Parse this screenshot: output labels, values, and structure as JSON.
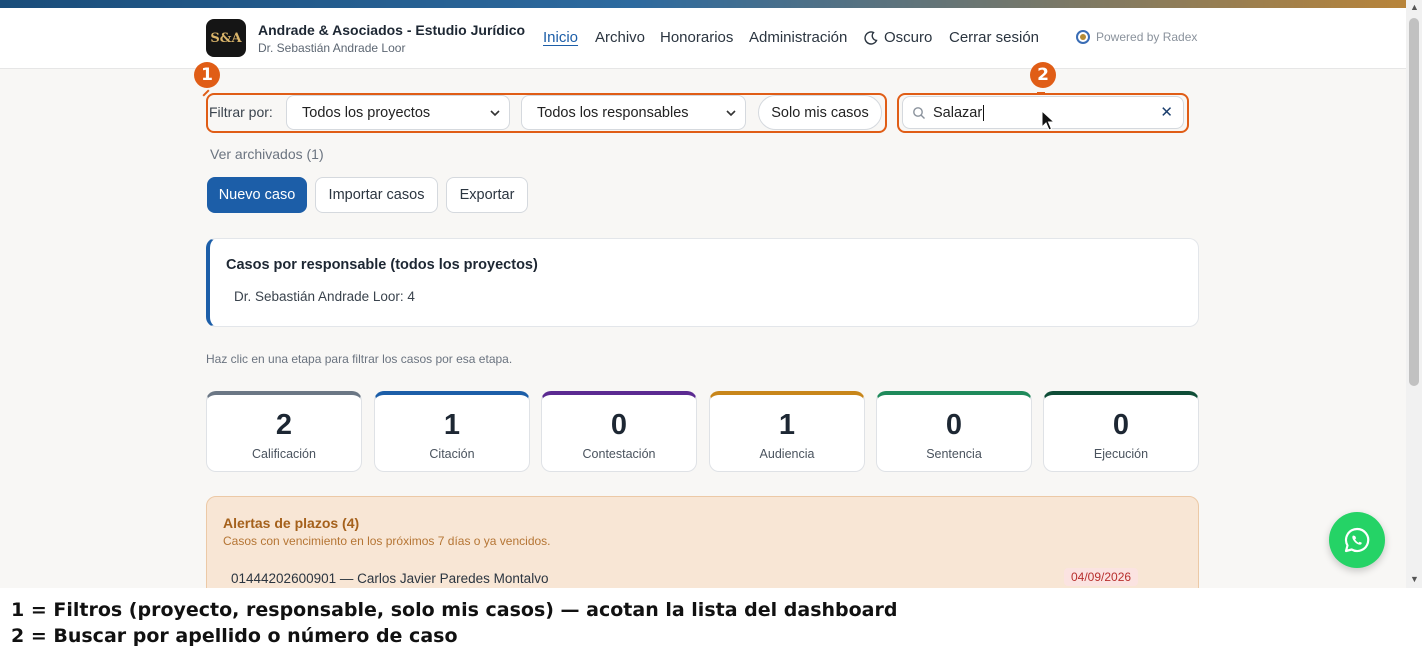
{
  "header": {
    "logo_text": "S&A",
    "firm_title": "Andrade & Asociados - Estudio Jurídico",
    "firm_subtitle": "Dr. Sebastián Andrade Loor",
    "nav": {
      "inicio": "Inicio",
      "archivo": "Archivo",
      "honorarios": "Honorarios",
      "administracion": "Administración",
      "oscuro": "Oscuro",
      "cerrar_sesion": "Cerrar sesión"
    },
    "powered_by": "Powered by Radex"
  },
  "filters": {
    "label": "Filtrar por:",
    "proyecto_selected": "Todos los proyectos",
    "responsable_selected": "Todos los responsables",
    "solo_mis_casos": "Solo mis casos"
  },
  "search": {
    "value": "Salazar",
    "clear_icon": "close-icon"
  },
  "markers": {
    "one": "1",
    "two": "2"
  },
  "actions": {
    "ver_archivados": "Ver archivados (1)",
    "nuevo_caso": "Nuevo caso",
    "importar_casos": "Importar casos",
    "exportar": "Exportar"
  },
  "responsables_card": {
    "title": "Casos por responsable (todos los proyectos)",
    "item": "Dr. Sebastián Andrade Loor: 4"
  },
  "stage_hint": "Haz clic en una etapa para filtrar los casos por esa etapa.",
  "stages": [
    {
      "count": "2",
      "label": "Calificación",
      "color": "#6b7785"
    },
    {
      "count": "1",
      "label": "Citación",
      "color": "#1c5ea8"
    },
    {
      "count": "0",
      "label": "Contestación",
      "color": "#5b2a91"
    },
    {
      "count": "1",
      "label": "Audiencia",
      "color": "#c8861a"
    },
    {
      "count": "0",
      "label": "Sentencia",
      "color": "#1f8a5b"
    },
    {
      "count": "0",
      "label": "Ejecución",
      "color": "#0f4d37"
    }
  ],
  "alerts": {
    "title": "Alertas de plazos (4)",
    "subtitle": "Casos con vencimiento en los próximos 7 días o ya vencidos.",
    "row": "01444202600901 — Carlos Javier Paredes Montalvo",
    "row_date": "04/09/2026"
  },
  "legend": {
    "line1": "1 = Filtros (proyecto, responsable, solo mis casos) — acotan la lista del dashboard",
    "line2": "2 = Buscar por apellido o número de caso"
  },
  "colors": {
    "accent": "#1c5ea8",
    "highlight": "#e05d16",
    "whatsapp": "#25d366"
  }
}
